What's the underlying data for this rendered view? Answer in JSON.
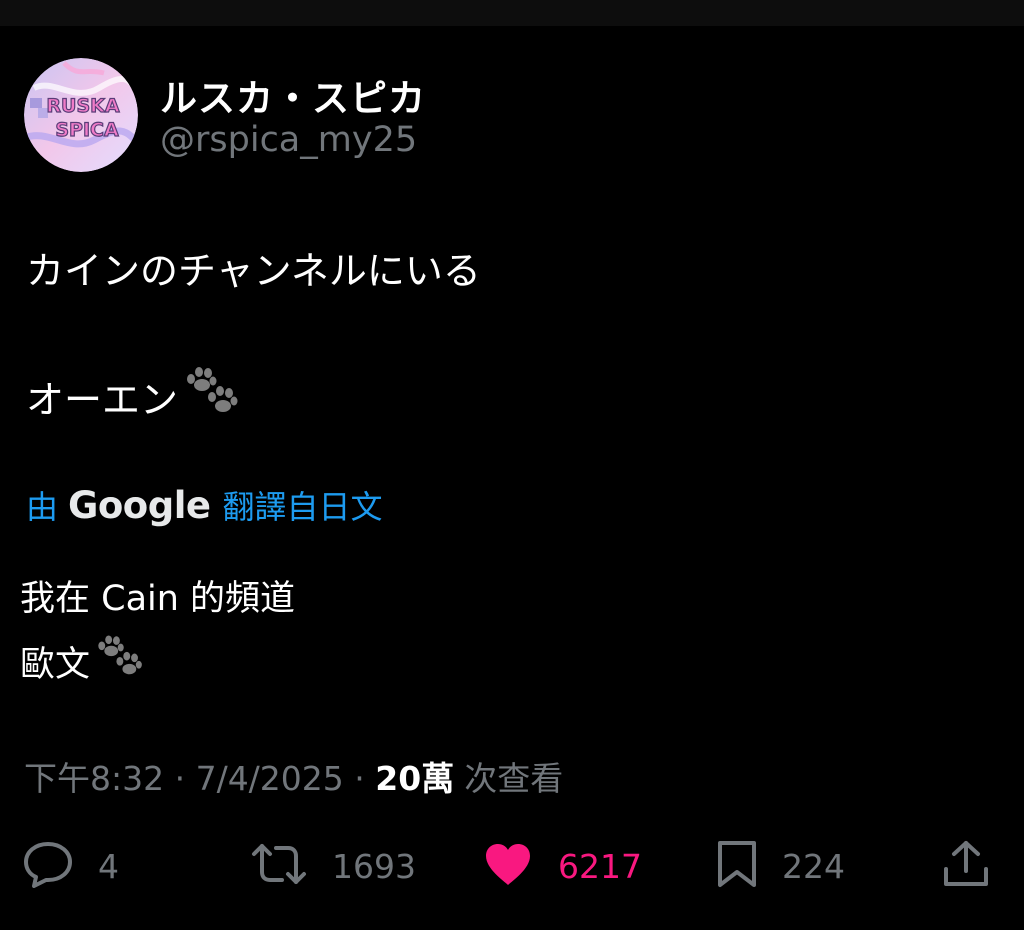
{
  "post": {
    "display_name": "ルスカ・スピカ",
    "handle": "@rspica_my25",
    "avatar_text_line1": "RUSKA",
    "avatar_text_line2": "SPICA",
    "body_line1": "カインのチャンネルにいる",
    "body_line2": "オーエン",
    "emoji": "paw-prints-icon"
  },
  "translation": {
    "by": "由",
    "provider": "Google",
    "from": "翻譯自日文",
    "line1": "我在 Cain 的頻道",
    "line2": "歐文"
  },
  "meta": {
    "timestamp": "下午8:32 · 7/4/2025 · ",
    "views_count": "20萬",
    "views_label": "次查看"
  },
  "actions": {
    "replies": "4",
    "reposts": "1693",
    "likes": "6217",
    "bookmarks": "224",
    "liked": true
  },
  "colors": {
    "accent": "#1d9bf0",
    "like": "#f91880",
    "muted": "#71767b",
    "background": "#000000"
  }
}
